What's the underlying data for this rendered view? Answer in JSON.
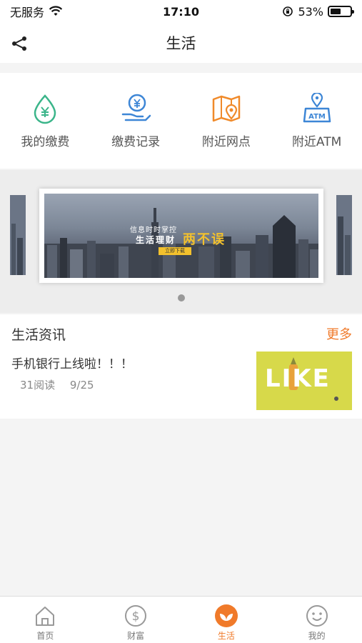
{
  "status_bar": {
    "carrier": "无服务",
    "time": "17:10",
    "battery": "53%",
    "battery_level": 0.53
  },
  "nav": {
    "title": "生活",
    "share_icon": "share-icon"
  },
  "services": [
    {
      "label": "我的缴费",
      "icon": "yuan-drop-icon",
      "color": "#3bb58a"
    },
    {
      "label": "缴费记录",
      "icon": "yuan-hand-icon",
      "color": "#3d86d6"
    },
    {
      "label": "附近网点",
      "icon": "map-pin-icon",
      "color": "#f08a2a"
    },
    {
      "label": "附近ATM",
      "icon": "atm-location-icon",
      "color": "#3d86d6"
    }
  ],
  "banner": {
    "line1": "信息时时掌控",
    "line2": "生活理财",
    "line3": "两不误",
    "button": "立即下载"
  },
  "news": {
    "header": "生活资讯",
    "more": "更多",
    "items": [
      {
        "title": "手机银行上线啦！！！",
        "reads": "31阅读",
        "date": "9/25",
        "thumb_text": "LIKE"
      }
    ]
  },
  "tabbar": {
    "items": [
      {
        "label": "首页",
        "icon": "home-icon",
        "active": false
      },
      {
        "label": "财富",
        "icon": "dollar-circle-icon",
        "active": false
      },
      {
        "label": "生活",
        "icon": "leaf-icon",
        "active": true
      },
      {
        "label": "我的",
        "icon": "smiley-icon",
        "active": false
      }
    ]
  },
  "colors": {
    "accent": "#f07a2a",
    "green": "#3bb58a",
    "blue": "#3d86d6"
  }
}
